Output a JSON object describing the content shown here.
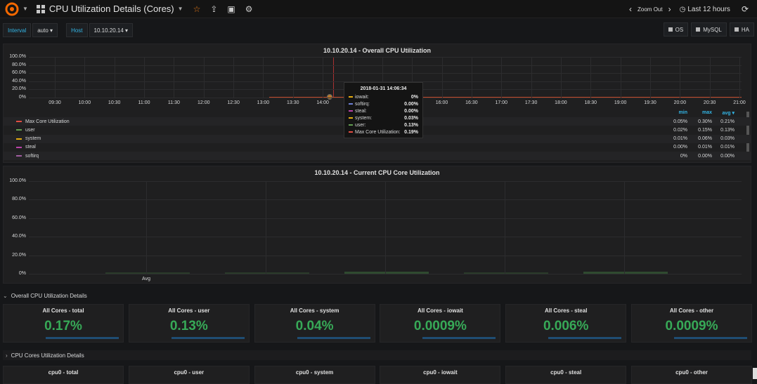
{
  "topbar": {
    "title": "CPU Utilization Details (Cores)",
    "zoom_out": "Zoom Out",
    "time_range": "Last 12 hours"
  },
  "variables": {
    "interval_label": "Interval",
    "interval_value": "auto",
    "host_label": "Host",
    "host_value": "10.10.20.14"
  },
  "links": [
    "OS",
    "MySQL",
    "HA"
  ],
  "overall_panel": {
    "title": "10.10.20.14 - Overall CPU Utilization",
    "y_ticks": [
      "100.0%",
      "80.0%",
      "60.0%",
      "40.0%",
      "20.0%",
      "0%"
    ],
    "x_ticks": [
      "09:30",
      "10:00",
      "10:30",
      "11:00",
      "11:30",
      "12:00",
      "12:30",
      "13:00",
      "13:30",
      "14:00",
      "14:30",
      "15:00",
      "15:30",
      "16:00",
      "16:30",
      "17:00",
      "17:30",
      "18:00",
      "18:30",
      "19:00",
      "19:30",
      "20:00",
      "20:30",
      "21:00"
    ],
    "legend_headers": {
      "min": "min",
      "max": "max",
      "avg": "avg"
    },
    "legend": [
      {
        "name": "Max Core Utilization",
        "color": "#e24d42",
        "min": "0.05%",
        "max": "0.30%",
        "avg": "0.21%"
      },
      {
        "name": "user",
        "color": "#629e51",
        "min": "0.02%",
        "max": "0.15%",
        "avg": "0.13%"
      },
      {
        "name": "system",
        "color": "#e5ac0e",
        "min": "0.01%",
        "max": "0.06%",
        "avg": "0.03%"
      },
      {
        "name": "steal",
        "color": "#ba43a9",
        "min": "0.00%",
        "max": "0.01%",
        "avg": "0.01%"
      },
      {
        "name": "softirq",
        "color": "#a05da0",
        "min": "0%",
        "max": "0.00%",
        "avg": "0.00%"
      }
    ]
  },
  "tooltip": {
    "time": "2018-01-31 14:06:34",
    "rows": [
      {
        "name": "iowait:",
        "value": "0%",
        "color": "#e5ac0e"
      },
      {
        "name": "softirq:",
        "value": "0.00%",
        "color": "#6d7fd4"
      },
      {
        "name": "steal:",
        "value": "0.00%",
        "color": "#ba43a9"
      },
      {
        "name": "system:",
        "value": "0.03%",
        "color": "#e5ac0e"
      },
      {
        "name": "user:",
        "value": "0.13%",
        "color": "#629e51"
      },
      {
        "name": "Max Core Utilization:",
        "value": "0.19%",
        "color": "#e24d42"
      }
    ]
  },
  "core_panel": {
    "title": "10.10.20.14 - Current CPU Core Utilization",
    "y_ticks": [
      "100.0%",
      "80.0%",
      "60.0%",
      "40.0%",
      "20.0%",
      "0%"
    ],
    "x_ticks": [
      "Avg"
    ]
  },
  "row_overall": "Overall CPU Utilization Details",
  "row_cores": "CPU Cores Utilization Details",
  "stats": [
    {
      "title": "All Cores - total",
      "value": "0.17%"
    },
    {
      "title": "All Cores - user",
      "value": "0.13%"
    },
    {
      "title": "All Cores - system",
      "value": "0.04%"
    },
    {
      "title": "All Cores - iowait",
      "value": "0.0009%"
    },
    {
      "title": "All Cores - steal",
      "value": "0.006%"
    },
    {
      "title": "All Cores - other",
      "value": "0.0009%"
    }
  ],
  "cpu0_stats": [
    {
      "title": "cpu0 - total"
    },
    {
      "title": "cpu0 - user"
    },
    {
      "title": "cpu0 - system"
    },
    {
      "title": "cpu0 - iowait"
    },
    {
      "title": "cpu0 - steal"
    },
    {
      "title": "cpu0 - other"
    }
  ]
}
